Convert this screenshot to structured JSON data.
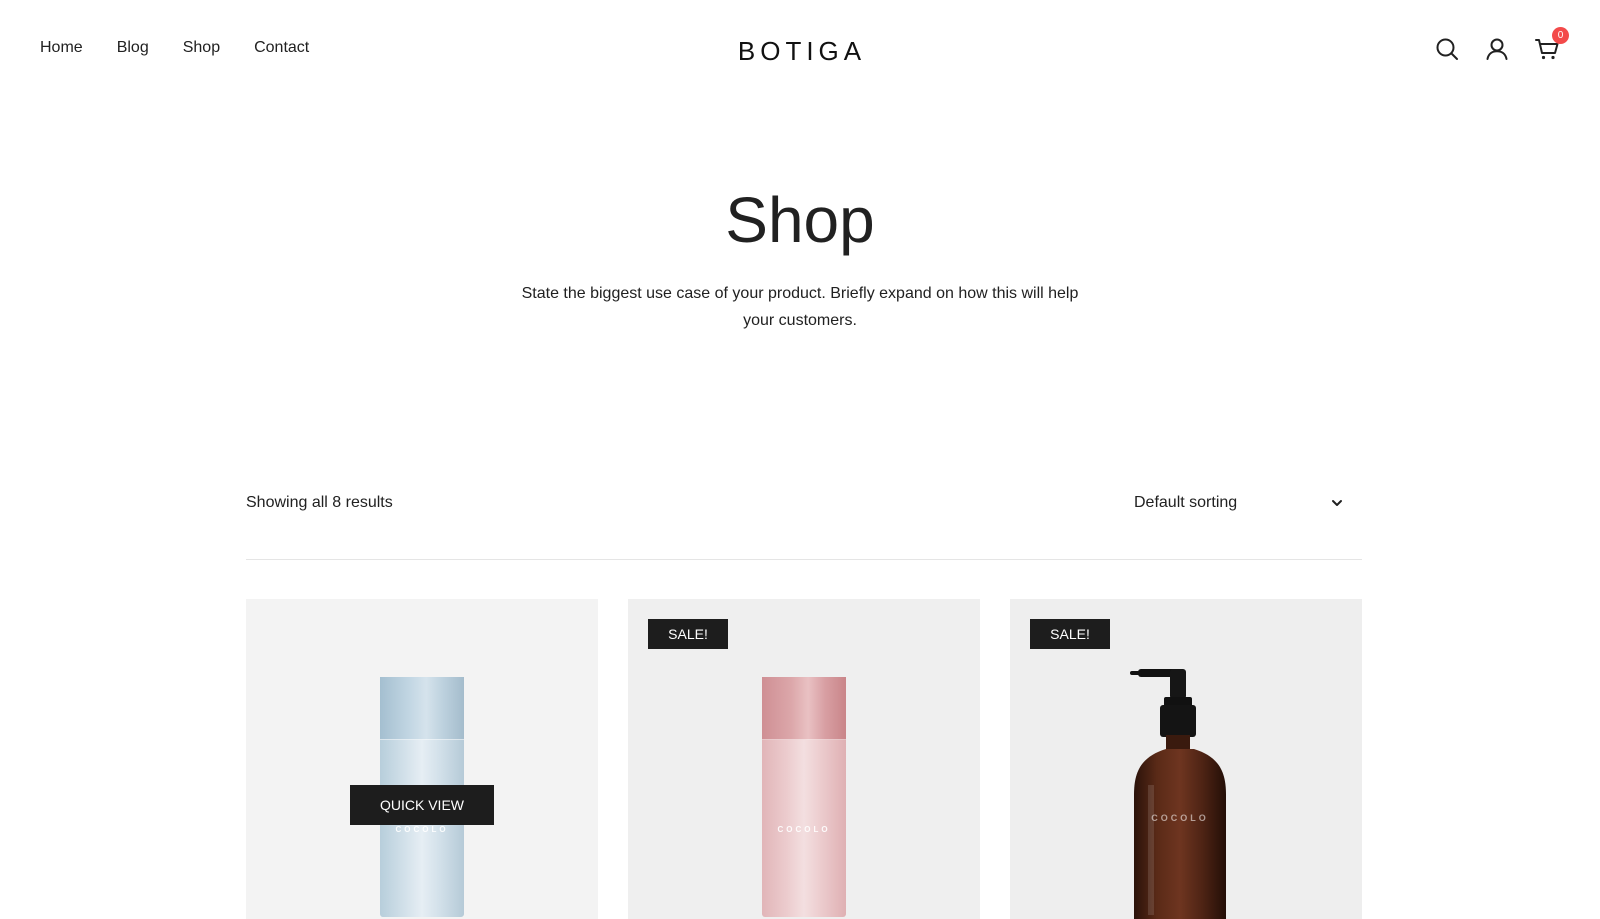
{
  "header": {
    "nav": [
      "Home",
      "Blog",
      "Shop",
      "Contact"
    ],
    "logo": "BOTIGA",
    "cart_count": "0"
  },
  "hero": {
    "title": "Shop",
    "description": "State the biggest use case of your product. Briefly expand on how this will help your customers."
  },
  "toolbar": {
    "result_count": "Showing all 8 results",
    "sort_selected": "Default sorting"
  },
  "products": [
    {
      "badge": "",
      "quick_view": "QUICK VIEW",
      "label": "COCOLO"
    },
    {
      "badge": "SALE!",
      "label": "COCOLO"
    },
    {
      "badge": "SALE!",
      "label": "COCOLO"
    }
  ],
  "colors": {
    "text": "#212121",
    "badge_bg": "#1d1d1d",
    "cart_badge": "#f34a4a",
    "card_bg": "#f2f2f2"
  }
}
